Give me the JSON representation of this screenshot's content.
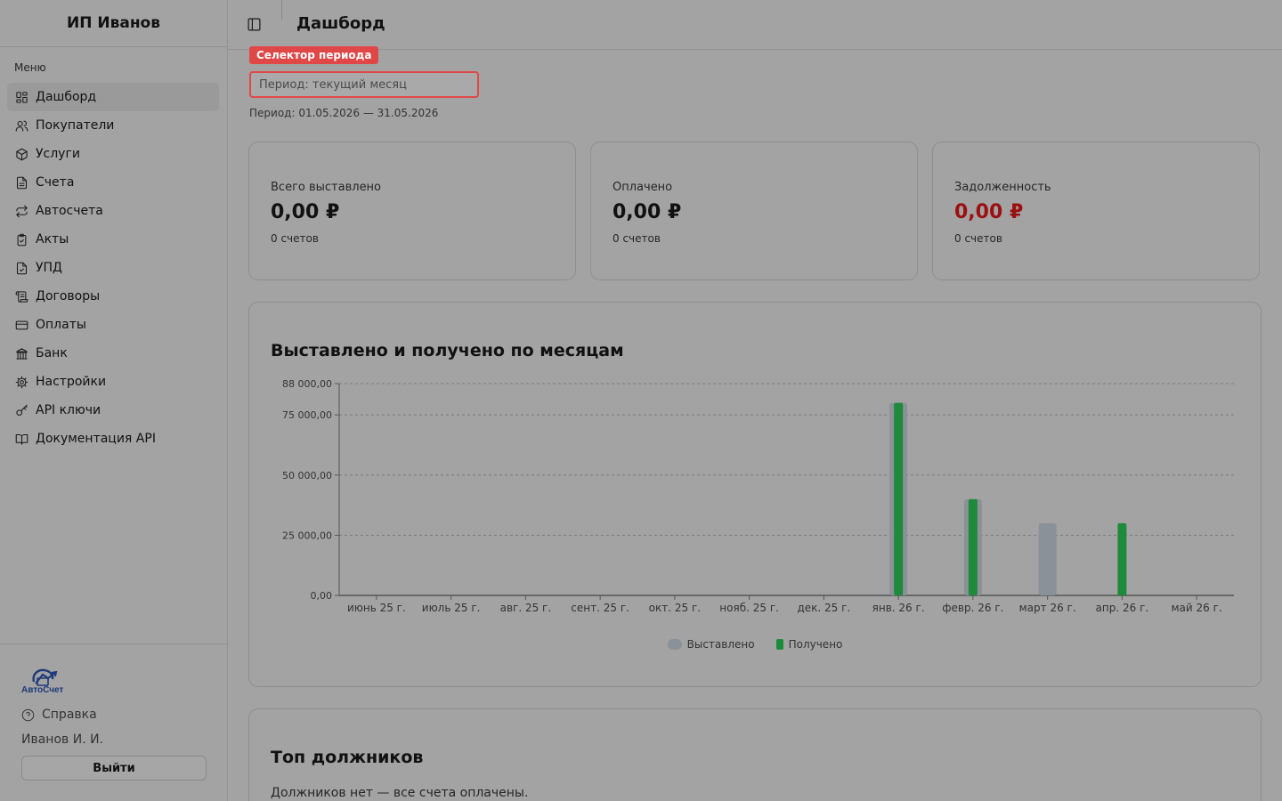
{
  "brand": "ИП Иванов",
  "menu_label": "Меню",
  "nav": [
    {
      "label": "Дашборд",
      "icon": "dashboard-icon",
      "active": true
    },
    {
      "label": "Покупатели",
      "icon": "users-icon"
    },
    {
      "label": "Услуги",
      "icon": "package-icon"
    },
    {
      "label": "Счета",
      "icon": "document-icon"
    },
    {
      "label": "Автосчета",
      "icon": "repeat-icon"
    },
    {
      "label": "Акты",
      "icon": "clipboard-check-icon"
    },
    {
      "label": "УПД",
      "icon": "file-check-icon"
    },
    {
      "label": "Договоры",
      "icon": "scroll-icon"
    },
    {
      "label": "Оплаты",
      "icon": "credit-card-icon"
    },
    {
      "label": "Банк",
      "icon": "bank-icon"
    },
    {
      "label": "Настройки",
      "icon": "gear-icon"
    },
    {
      "label": "API ключи",
      "icon": "key-icon"
    },
    {
      "label": "Документация API",
      "icon": "book-icon"
    }
  ],
  "footer": {
    "logo_text": "АвтоСчет",
    "help": "Справка",
    "user": "Иванов И. И.",
    "logout": "Выйти"
  },
  "page_title": "Дашборд",
  "period_tag": "Селектор периода",
  "period_placeholder": "Период: текущий месяц",
  "period_text": "Период: 01.05.2026 — 31.05.2026",
  "cards": [
    {
      "label": "Всего выставлено",
      "value": "0,00 ₽",
      "sub": "0 счетов"
    },
    {
      "label": "Оплачено",
      "value": "0,00 ₽",
      "sub": "0 счетов"
    },
    {
      "label": "Задолженность",
      "value": "0,00 ₽",
      "sub": "0 счетов",
      "highlight": "#9b1010"
    }
  ],
  "chart_title": "Выставлено и получено по месяцам",
  "chart_data": {
    "type": "bar",
    "title": "Выставлено и получено по месяцам",
    "categories": [
      "июнь 25 г.",
      "июль 25 г.",
      "авг. 25 г.",
      "сент. 25 г.",
      "окт. 25 г.",
      "нояб. 25 г.",
      "дек. 25 г.",
      "янв. 26 г.",
      "февр. 26 г.",
      "март 26 г.",
      "апр. 26 г.",
      "май 26 г."
    ],
    "series": [
      {
        "name": "Выставлено",
        "color": "#8b9198",
        "values": [
          0,
          0,
          0,
          0,
          0,
          0,
          0,
          80000,
          40000,
          30000,
          0,
          0
        ]
      },
      {
        "name": "Получено",
        "color": "#1e8a3c",
        "values": [
          0,
          0,
          0,
          0,
          0,
          0,
          0,
          80000,
          40000,
          0,
          30000,
          0
        ]
      }
    ],
    "yticks": [
      "0,00",
      "25 000,00",
      "50 000,00",
      "75 000,00",
      "88 000,00"
    ],
    "ytick_values": [
      0,
      25000,
      50000,
      75000,
      88000
    ],
    "ylim": [
      0,
      88000
    ],
    "grid": true,
    "legend": "bottom-center"
  },
  "debtors_title": "Топ должников",
  "debtors_empty": "Должников нет — все счета оплачены."
}
